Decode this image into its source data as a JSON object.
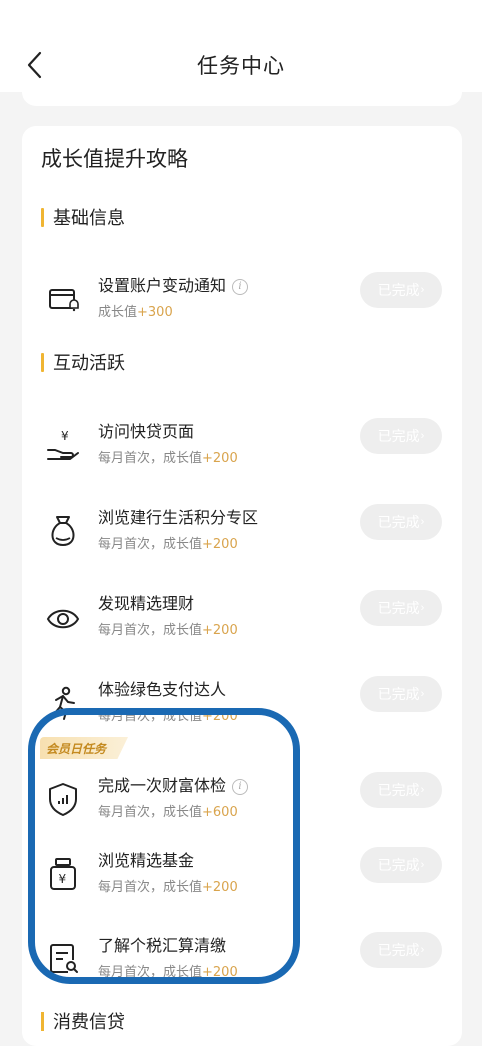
{
  "header": {
    "title": "任务中心"
  },
  "card": {
    "title": "成长值提升攻略"
  },
  "sections": {
    "basic": "基础信息",
    "interactive": "互动活跃",
    "consume": "消费信贷"
  },
  "vip_tag": "会员日任务",
  "done_label": "已完成",
  "items": [
    {
      "name": "设置账户变动通知",
      "has_info": true,
      "prefix": "成长值",
      "points": "+300",
      "icon": "card-bell-icon"
    },
    {
      "name": "访问快贷页面",
      "has_info": false,
      "prefix": "每月首次，成长值",
      "points": "+200",
      "icon": "hand-coin-icon"
    },
    {
      "name": "浏览建行生活积分专区",
      "has_info": false,
      "prefix": "每月首次，成长值",
      "points": "+200",
      "icon": "money-bag-icon"
    },
    {
      "name": "发现精选理财",
      "has_info": false,
      "prefix": "每月首次，成长值",
      "points": "+200",
      "icon": "eye-icon"
    },
    {
      "name": "体验绿色支付达人",
      "has_info": false,
      "prefix": "每月首次，成长值",
      "points": "+200",
      "icon": "runner-icon"
    },
    {
      "name": "完成一次财富体检",
      "has_info": true,
      "prefix": "每月首次，成长值",
      "points": "+600",
      "icon": "shield-chart-icon"
    },
    {
      "name": "浏览精选基金",
      "has_info": false,
      "prefix": "每月首次，成长值",
      "points": "+200",
      "icon": "yuan-jar-icon"
    },
    {
      "name": "了解个税汇算清缴",
      "has_info": false,
      "prefix": "每月首次，成长值",
      "points": "+200",
      "icon": "doc-search-icon"
    }
  ],
  "colors": {
    "accent": "#f0b532",
    "points": "#d9a44d",
    "highlight": "#1a69b3"
  }
}
